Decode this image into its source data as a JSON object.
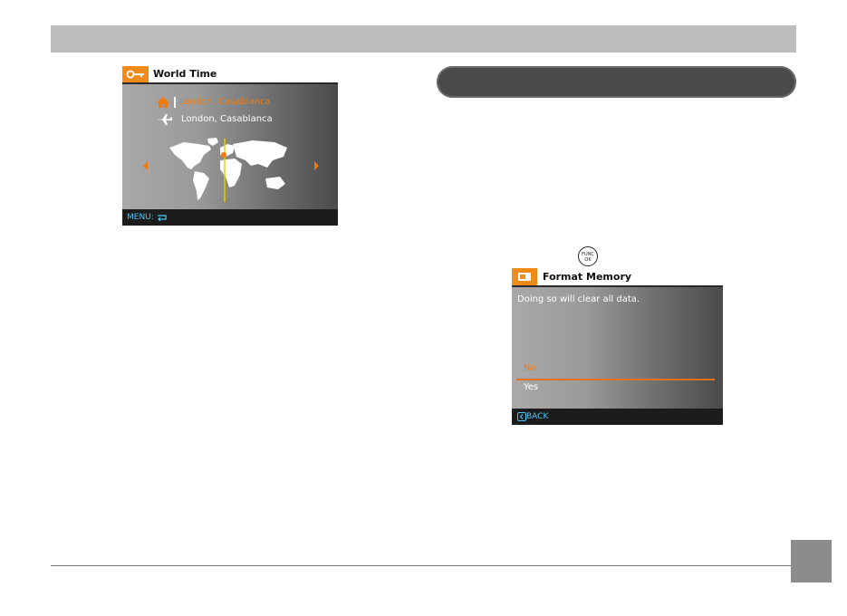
{
  "world_time": {
    "title": "World Time",
    "home_city": "London, Casablanca",
    "travel_city": "London, Casablanca",
    "footer": "MENU:",
    "icons": {
      "title": "wrench-icon",
      "home": "house-icon",
      "travel": "airplane-icon",
      "back": "return-icon"
    }
  },
  "button_icon": {
    "line1": "FUNC",
    "line2": "OK"
  },
  "format_memory": {
    "title": "Format Memory",
    "message": "Doing so will clear all data.",
    "options": [
      "No",
      "Yes"
    ],
    "selected": "No",
    "footer": "BACK"
  },
  "colors": {
    "accent": "#f07a10",
    "hint": "#4fc4f0",
    "header_bar": "#bdbdbd",
    "banner": "#4a4a4a",
    "page_box": "#8c8c8c"
  }
}
